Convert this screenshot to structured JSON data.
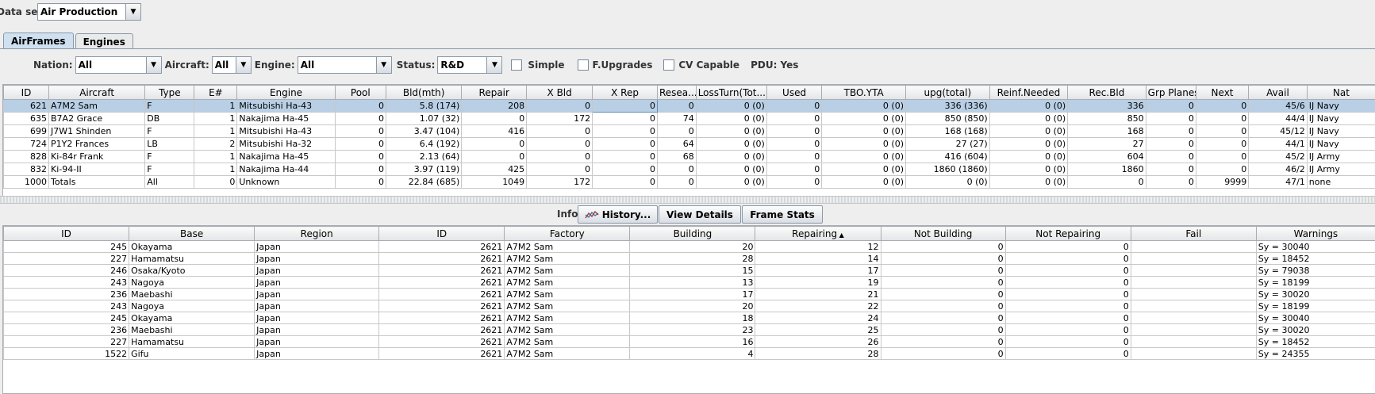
{
  "dataset": {
    "label": "Data set:",
    "value": "Air Production"
  },
  "tabs": [
    "AirFrames",
    "Engines"
  ],
  "filters": {
    "nation_label": "Nation:",
    "nation_value": "All",
    "aircraft_label": "Aircraft:",
    "aircraft_value": "All",
    "engine_label": "Engine:",
    "engine_value": "All",
    "status_label": "Status:",
    "status_value": "R&D",
    "simple_label": "Simple",
    "fupgrades_label": "F.Upgrades",
    "cvcapable_label": "CV Capable",
    "pdu_label": "PDU: Yes"
  },
  "airframes": {
    "columns": [
      "ID",
      "Aircraft",
      "Type",
      "E#",
      "Engine",
      "Pool",
      "Bld(mth)",
      "Repair",
      "X Bld",
      "X Rep",
      "Resea...",
      "LossTurn(Tot...",
      "Used",
      "TBO.YTA",
      "upg(total)",
      "Reinf.Needed",
      "Rec.Bld",
      "Grp Planes",
      "Next",
      "Avail",
      "Nat"
    ],
    "rows": [
      [
        "621",
        "A7M2 Sam",
        "F",
        "1",
        "Mitsubishi Ha-43",
        "0",
        "5.8 (174)",
        "208",
        "0",
        "0",
        "0",
        "0 (0)",
        "0",
        "0 (0)",
        "336 (336)",
        "0 (0)",
        "336",
        "0",
        "0",
        "45/6",
        "IJ Navy"
      ],
      [
        "635",
        "B7A2 Grace",
        "DB",
        "1",
        "Nakajima Ha-45",
        "0",
        "1.07 (32)",
        "0",
        "172",
        "0",
        "74",
        "0 (0)",
        "0",
        "0 (0)",
        "850 (850)",
        "0 (0)",
        "850",
        "0",
        "0",
        "44/4",
        "IJ Navy"
      ],
      [
        "699",
        "J7W1 Shinden",
        "F",
        "1",
        "Mitsubishi Ha-43",
        "0",
        "3.47 (104)",
        "416",
        "0",
        "0",
        "0",
        "0 (0)",
        "0",
        "0 (0)",
        "168 (168)",
        "0 (0)",
        "168",
        "0",
        "0",
        "45/12",
        "IJ Navy"
      ],
      [
        "724",
        "P1Y2 Frances",
        "LB",
        "2",
        "Mitsubishi Ha-32",
        "0",
        "6.4 (192)",
        "0",
        "0",
        "0",
        "64",
        "0 (0)",
        "0",
        "0 (0)",
        "27 (27)",
        "0 (0)",
        "27",
        "0",
        "0",
        "44/1",
        "IJ Navy"
      ],
      [
        "828",
        "Ki-84r Frank",
        "F",
        "1",
        "Nakajima Ha-45",
        "0",
        "2.13 (64)",
        "0",
        "0",
        "0",
        "68",
        "0 (0)",
        "0",
        "0 (0)",
        "416 (604)",
        "0 (0)",
        "604",
        "0",
        "0",
        "45/2",
        "IJ Army"
      ],
      [
        "832",
        "Ki-94-II",
        "F",
        "1",
        "Nakajima Ha-44",
        "0",
        "3.97 (119)",
        "425",
        "0",
        "0",
        "0",
        "0 (0)",
        "0",
        "0 (0)",
        "1860 (1860)",
        "0 (0)",
        "1860",
        "0",
        "0",
        "46/2",
        "IJ Army"
      ],
      [
        "1000",
        "Totals",
        "All",
        "0",
        "Unknown",
        "0",
        "22.84 (685)",
        "1049",
        "172",
        "0",
        "0",
        "0 (0)",
        "0",
        "0 (0)",
        "0 (0)",
        "0 (0)",
        "0",
        "0",
        "9999",
        "47/1",
        "none"
      ]
    ]
  },
  "info": {
    "label": "Info:",
    "history": "History...",
    "details": "View Details",
    "stats": "Frame Stats"
  },
  "factories": {
    "columns": [
      "ID",
      "Base",
      "Region",
      "ID",
      "Factory",
      "Building",
      "Repairing",
      "Not Building",
      "Not Repairing",
      "Fail",
      "Warnings"
    ],
    "rows": [
      [
        "245",
        "Okayama",
        "Japan",
        "2621",
        "A7M2 Sam",
        "20",
        "12",
        "0",
        "0",
        "",
        "Sy = 30040"
      ],
      [
        "227",
        "Hamamatsu",
        "Japan",
        "2621",
        "A7M2 Sam",
        "28",
        "14",
        "0",
        "0",
        "",
        "Sy = 18452"
      ],
      [
        "246",
        "Osaka/Kyoto",
        "Japan",
        "2621",
        "A7M2 Sam",
        "15",
        "17",
        "0",
        "0",
        "",
        "Sy = 79038"
      ],
      [
        "243",
        "Nagoya",
        "Japan",
        "2621",
        "A7M2 Sam",
        "13",
        "19",
        "0",
        "0",
        "",
        "Sy = 18199"
      ],
      [
        "236",
        "Maebashi",
        "Japan",
        "2621",
        "A7M2 Sam",
        "17",
        "21",
        "0",
        "0",
        "",
        "Sy = 30020"
      ],
      [
        "243",
        "Nagoya",
        "Japan",
        "2621",
        "A7M2 Sam",
        "20",
        "22",
        "0",
        "0",
        "",
        "Sy = 18199"
      ],
      [
        "245",
        "Okayama",
        "Japan",
        "2621",
        "A7M2 Sam",
        "18",
        "24",
        "0",
        "0",
        "",
        "Sy = 30040"
      ],
      [
        "236",
        "Maebashi",
        "Japan",
        "2621",
        "A7M2 Sam",
        "23",
        "25",
        "0",
        "0",
        "",
        "Sy = 30020"
      ],
      [
        "227",
        "Hamamatsu",
        "Japan",
        "2621",
        "A7M2 Sam",
        "16",
        "26",
        "0",
        "0",
        "",
        "Sy = 18452"
      ],
      [
        "1522",
        "Gifu",
        "Japan",
        "2621",
        "A7M2 Sam",
        "4",
        "28",
        "0",
        "0",
        "",
        "Sy = 24355"
      ]
    ]
  }
}
